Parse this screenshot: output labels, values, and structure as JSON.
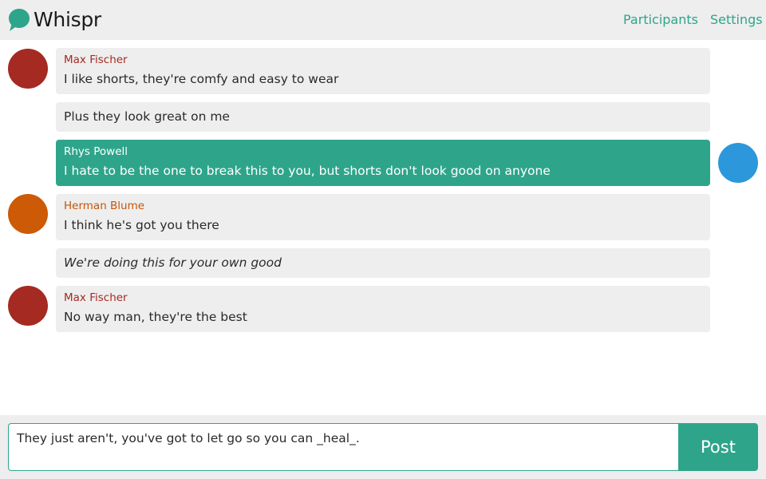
{
  "app": {
    "title": "Whispr",
    "logo_icon": "chat-bubble-icon",
    "accent": "#2ea58a"
  },
  "nav": {
    "participants": "Participants",
    "settings": "Settings"
  },
  "messages": [
    {
      "author": "Max Fischer",
      "text": "I like shorts, they're comfy and easy to wear",
      "avatar_color": "#a52a22",
      "author_color": "#a52a22"
    },
    {
      "text": "Plus they look great on me"
    },
    {
      "author": "Rhys Powell",
      "text": "I hate to be the one to break this to you, but shorts don't look good on anyone",
      "avatar_color": "#2d97db",
      "own": true
    },
    {
      "author": "Herman Blume",
      "text": "I think he's got you there",
      "avatar_color": "#cc5a06",
      "author_color": "#c4560a"
    },
    {
      "text": "We're doing this for your own good",
      "italic": true
    },
    {
      "author": "Max Fischer",
      "text": "No way man, they're the best",
      "avatar_color": "#a52a22",
      "author_color": "#a52a22"
    }
  ],
  "composer": {
    "value": "They just aren't, you've got to let go so you can _heal_.",
    "post_label": "Post"
  }
}
